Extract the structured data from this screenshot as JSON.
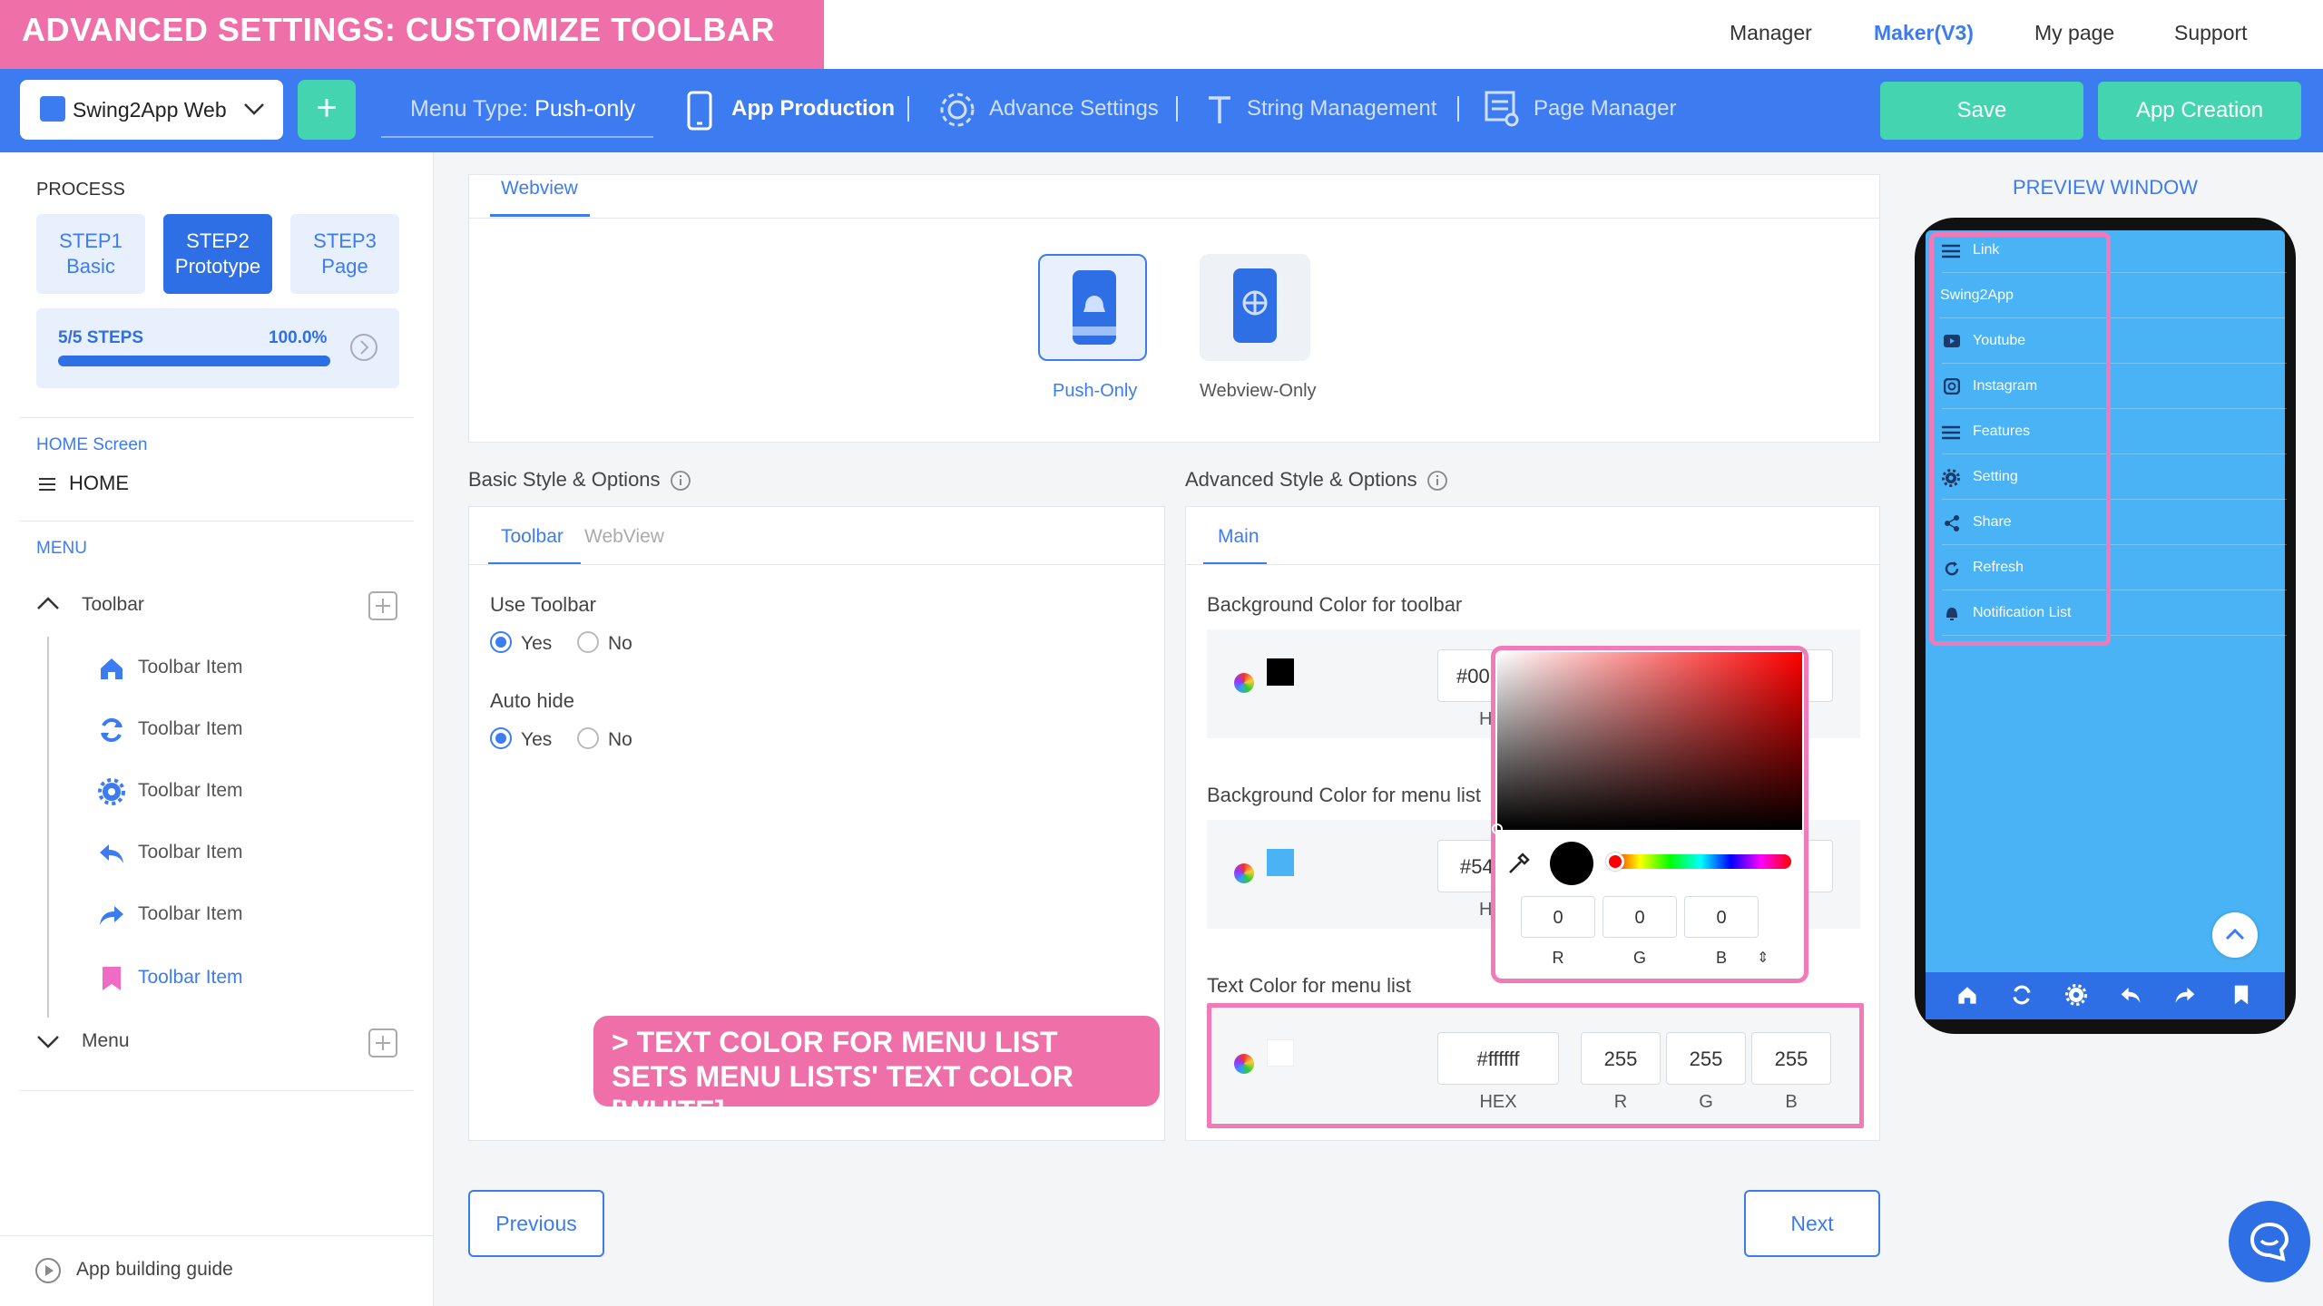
{
  "banner": "ADVANCED SETTINGS: CUSTOMIZE TOOLBAR COLOR",
  "topnav": [
    "Manager",
    "Maker(V3)",
    "My page",
    "Support"
  ],
  "app_selector": {
    "label": "Swing2App Web"
  },
  "add_button": "+",
  "menu_type": {
    "key": "Menu Type:",
    "value": "Push-only"
  },
  "nav": {
    "app_production": "App Production",
    "advance_settings": "Advance Settings",
    "string_management": "String Management",
    "page_manager": "Page Manager"
  },
  "buttons": {
    "save": "Save",
    "app_creation": "App Creation",
    "previous": "Previous",
    "next": "Next"
  },
  "sidebar": {
    "process": "PROCESS",
    "steps": [
      {
        "line1": "STEP1",
        "line2": "Basic"
      },
      {
        "line1": "STEP2",
        "line2": "Prototype"
      },
      {
        "line1": "STEP3",
        "line2": "Page"
      }
    ],
    "progress_label": "5/5 STEPS",
    "progress_pct": "100.0%",
    "progress_value": 1.0,
    "home_section": "HOME Screen",
    "home_item": "HOME",
    "menu_section": "MENU",
    "toolbar_group": "Toolbar",
    "toolbar_items": [
      "Toolbar Item",
      "Toolbar Item",
      "Toolbar Item",
      "Toolbar Item",
      "Toolbar Item",
      "Toolbar Item"
    ],
    "menu_group": "Menu",
    "guide": "App building guide"
  },
  "type_panel": {
    "tab": "Webview",
    "options": [
      "Push-Only",
      "Webview-Only"
    ]
  },
  "basic": {
    "title": "Basic Style & Options",
    "tabs": [
      "Toolbar",
      "WebView"
    ],
    "use_toolbar": "Use Toolbar",
    "auto_hide": "Auto hide",
    "yes": "Yes",
    "no": "No"
  },
  "advanced": {
    "title": "Advanced Style & Options",
    "tab": "Main",
    "bg_toolbar": {
      "label": "Background Color for toolbar",
      "hex": "#00",
      "hex_caption": "H",
      "color": "#000000"
    },
    "bg_menu": {
      "label": "Background Color for menu list",
      "hex": "#54",
      "hex_caption": "H",
      "color": "#4ab3f5"
    },
    "text_menu": {
      "label": "Text Color for menu list",
      "hex": "#ffffff",
      "r": "255",
      "g": "255",
      "b": "255",
      "color": "#ffffff"
    },
    "captions": {
      "hex": "HEX",
      "r": "R",
      "g": "G",
      "b": "B"
    }
  },
  "picker": {
    "r": "0",
    "g": "0",
    "b": "0",
    "r_label": "R",
    "g_label": "G",
    "b_label": "B",
    "arrows": "⇕"
  },
  "callout": "> TEXT COLOR FOR MENU LIST SETS MENU LISTS' TEXT COLOR [WHITE]",
  "preview": {
    "title": "PREVIEW WINDOW",
    "menu": [
      {
        "icon": "menu-icon",
        "label": "Link"
      },
      {
        "icon": "",
        "label": "Swing2App"
      },
      {
        "icon": "youtube-icon",
        "label": "Youtube"
      },
      {
        "icon": "instagram-icon",
        "label": "Instagram"
      },
      {
        "icon": "menu-icon",
        "label": "Features"
      },
      {
        "icon": "gear-icon",
        "label": "Setting"
      },
      {
        "icon": "share-icon",
        "label": "Share"
      },
      {
        "icon": "refresh-icon",
        "label": "Refresh"
      },
      {
        "icon": "bell-icon",
        "label": "Notification List"
      }
    ]
  },
  "colors": {
    "brand": "#3d7cf0",
    "accent_green": "#45d4b0",
    "highlight_pink": "#f27ab8"
  }
}
